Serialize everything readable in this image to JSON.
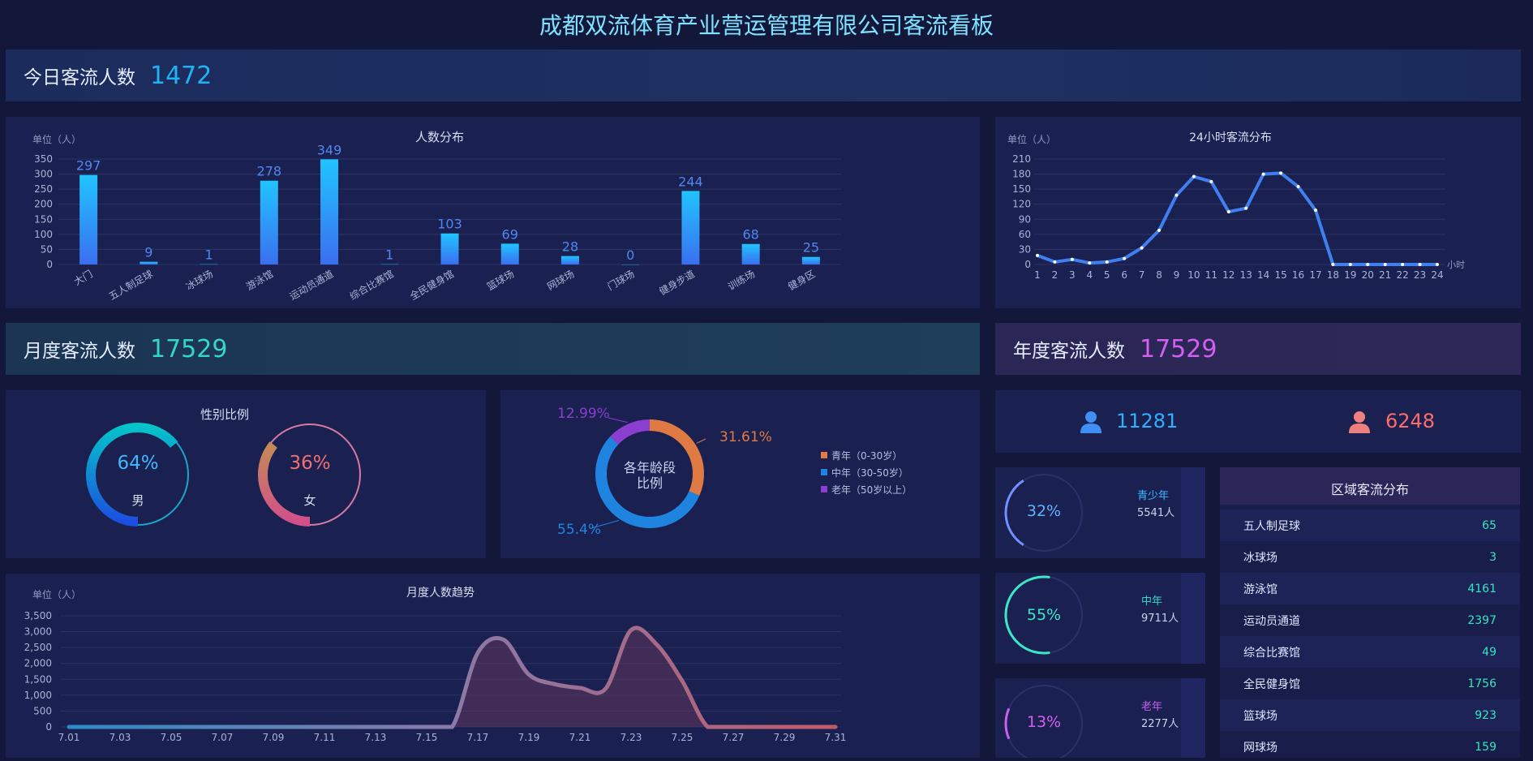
{
  "page_title": "成都双流体育产业营运管理有限公司客流看板",
  "today": {
    "label": "今日客流人数",
    "value": "1472"
  },
  "monthly": {
    "label": "月度客流人数",
    "value": "17529"
  },
  "yearly": {
    "label": "年度客流人数",
    "value": "17529"
  },
  "colors": {
    "accent_blue": "#1fb3f5",
    "accent_teal": "#35d6c8",
    "accent_purple": "#d35ff0",
    "bg": "#13173a",
    "panel": "#1a2150"
  },
  "gender_icons": {
    "male": "male-user-icon",
    "female": "female-user-icon"
  },
  "gender_counts": {
    "male": "11281",
    "female": "6248"
  },
  "gender": {
    "title": "性别比例",
    "male": {
      "percent": "64%",
      "label": "男",
      "fraction": 0.64
    },
    "female": {
      "percent": "36%",
      "label": "女",
      "fraction": 0.36
    }
  },
  "age_donut": {
    "center": [
      "各年龄段",
      "比例"
    ],
    "slices": [
      {
        "name": "青年（0-30岁）",
        "value": 31.61,
        "label": "31.61%",
        "color": "#e07a45"
      },
      {
        "name": "中年（30-50岁）",
        "value": 55.4,
        "label": "55.4%",
        "color": "#1f84e0"
      },
      {
        "name": "老年（50岁以上）",
        "value": 12.99,
        "label": "12.99%",
        "color": "#8a3fd0"
      }
    ]
  },
  "age_cards": [
    {
      "percent": "32%",
      "fraction": 0.32,
      "name": "青少年",
      "count": "5541人",
      "color": "#7090ff",
      "name_color": "#3fb8ff"
    },
    {
      "percent": "55%",
      "fraction": 0.55,
      "name": "中年",
      "count": "9711人",
      "color": "#3ee6c8",
      "name_color": "#35d6c8"
    },
    {
      "percent": "13%",
      "fraction": 0.13,
      "name": "老年",
      "count": "2277人",
      "color": "#c860f0",
      "name_color": "#c860f0"
    }
  ],
  "region": {
    "title": "区域客流分布",
    "rows": [
      {
        "name": "五人制足球",
        "value": "65"
      },
      {
        "name": "冰球场",
        "value": "3"
      },
      {
        "name": "游泳馆",
        "value": "4161"
      },
      {
        "name": "运动员通道",
        "value": "2397"
      },
      {
        "name": "综合比赛馆",
        "value": "49"
      },
      {
        "name": "全民健身馆",
        "value": "1756"
      },
      {
        "name": "篮球场",
        "value": "923"
      },
      {
        "name": "网球场",
        "value": "159"
      }
    ]
  },
  "chart_data": [
    {
      "type": "bar",
      "title": "人数分布",
      "ylabel": "单位（人）",
      "ylim": [
        0,
        350
      ],
      "yticks": [
        0,
        50,
        100,
        150,
        200,
        250,
        300,
        350
      ],
      "categories": [
        "大门",
        "五人制足球",
        "冰球场",
        "游泳馆",
        "运动员通道",
        "综合比赛馆",
        "全民健身馆",
        "篮球场",
        "网球场",
        "门球场",
        "健身步道",
        "训练场",
        "健身区"
      ],
      "values": [
        297,
        9,
        1,
        278,
        349,
        1,
        103,
        69,
        28,
        0,
        244,
        68,
        25
      ]
    },
    {
      "type": "line",
      "title": "24小时客流分布",
      "ylabel": "单位（人）",
      "xlabel": "小时",
      "ylim": [
        0,
        210
      ],
      "yticks": [
        0,
        30,
        60,
        90,
        120,
        150,
        180,
        210
      ],
      "x": [
        1,
        2,
        3,
        4,
        5,
        6,
        7,
        8,
        9,
        10,
        11,
        12,
        13,
        14,
        15,
        16,
        17,
        18,
        19,
        20,
        21,
        22,
        23,
        24
      ],
      "values": [
        18,
        5,
        10,
        3,
        5,
        12,
        33,
        68,
        138,
        175,
        165,
        105,
        112,
        180,
        182,
        155,
        108,
        0,
        0,
        0,
        0,
        0,
        0,
        0
      ]
    },
    {
      "type": "area",
      "title": "月度人数趋势",
      "ylabel": "单位（人）",
      "ylim": [
        0,
        3500
      ],
      "yticks": [
        "0",
        "500",
        "1,000",
        "1,500",
        "2,000",
        "2,500",
        "3,000",
        "3,500"
      ],
      "xticks": [
        "7.01",
        "7.03",
        "7.05",
        "7.07",
        "7.09",
        "7.11",
        "7.13",
        "7.15",
        "7.17",
        "7.19",
        "7.21",
        "7.23",
        "7.25",
        "7.27",
        "7.29",
        "7.31"
      ],
      "x": [
        "7.01",
        "7.02",
        "7.03",
        "7.04",
        "7.05",
        "7.06",
        "7.07",
        "7.08",
        "7.09",
        "7.10",
        "7.11",
        "7.12",
        "7.13",
        "7.14",
        "7.15",
        "7.16",
        "7.17",
        "7.18",
        "7.19",
        "7.20",
        "7.21",
        "7.22",
        "7.23",
        "7.24",
        "7.25",
        "7.26",
        "7.27",
        "7.28",
        "7.29",
        "7.30",
        "7.31"
      ],
      "values": [
        0,
        0,
        0,
        0,
        0,
        0,
        0,
        0,
        0,
        0,
        0,
        0,
        0,
        0,
        0,
        0,
        2330,
        2750,
        1650,
        1350,
        1230,
        1200,
        3050,
        2600,
        1450,
        0,
        0,
        0,
        0,
        0,
        0
      ]
    }
  ]
}
